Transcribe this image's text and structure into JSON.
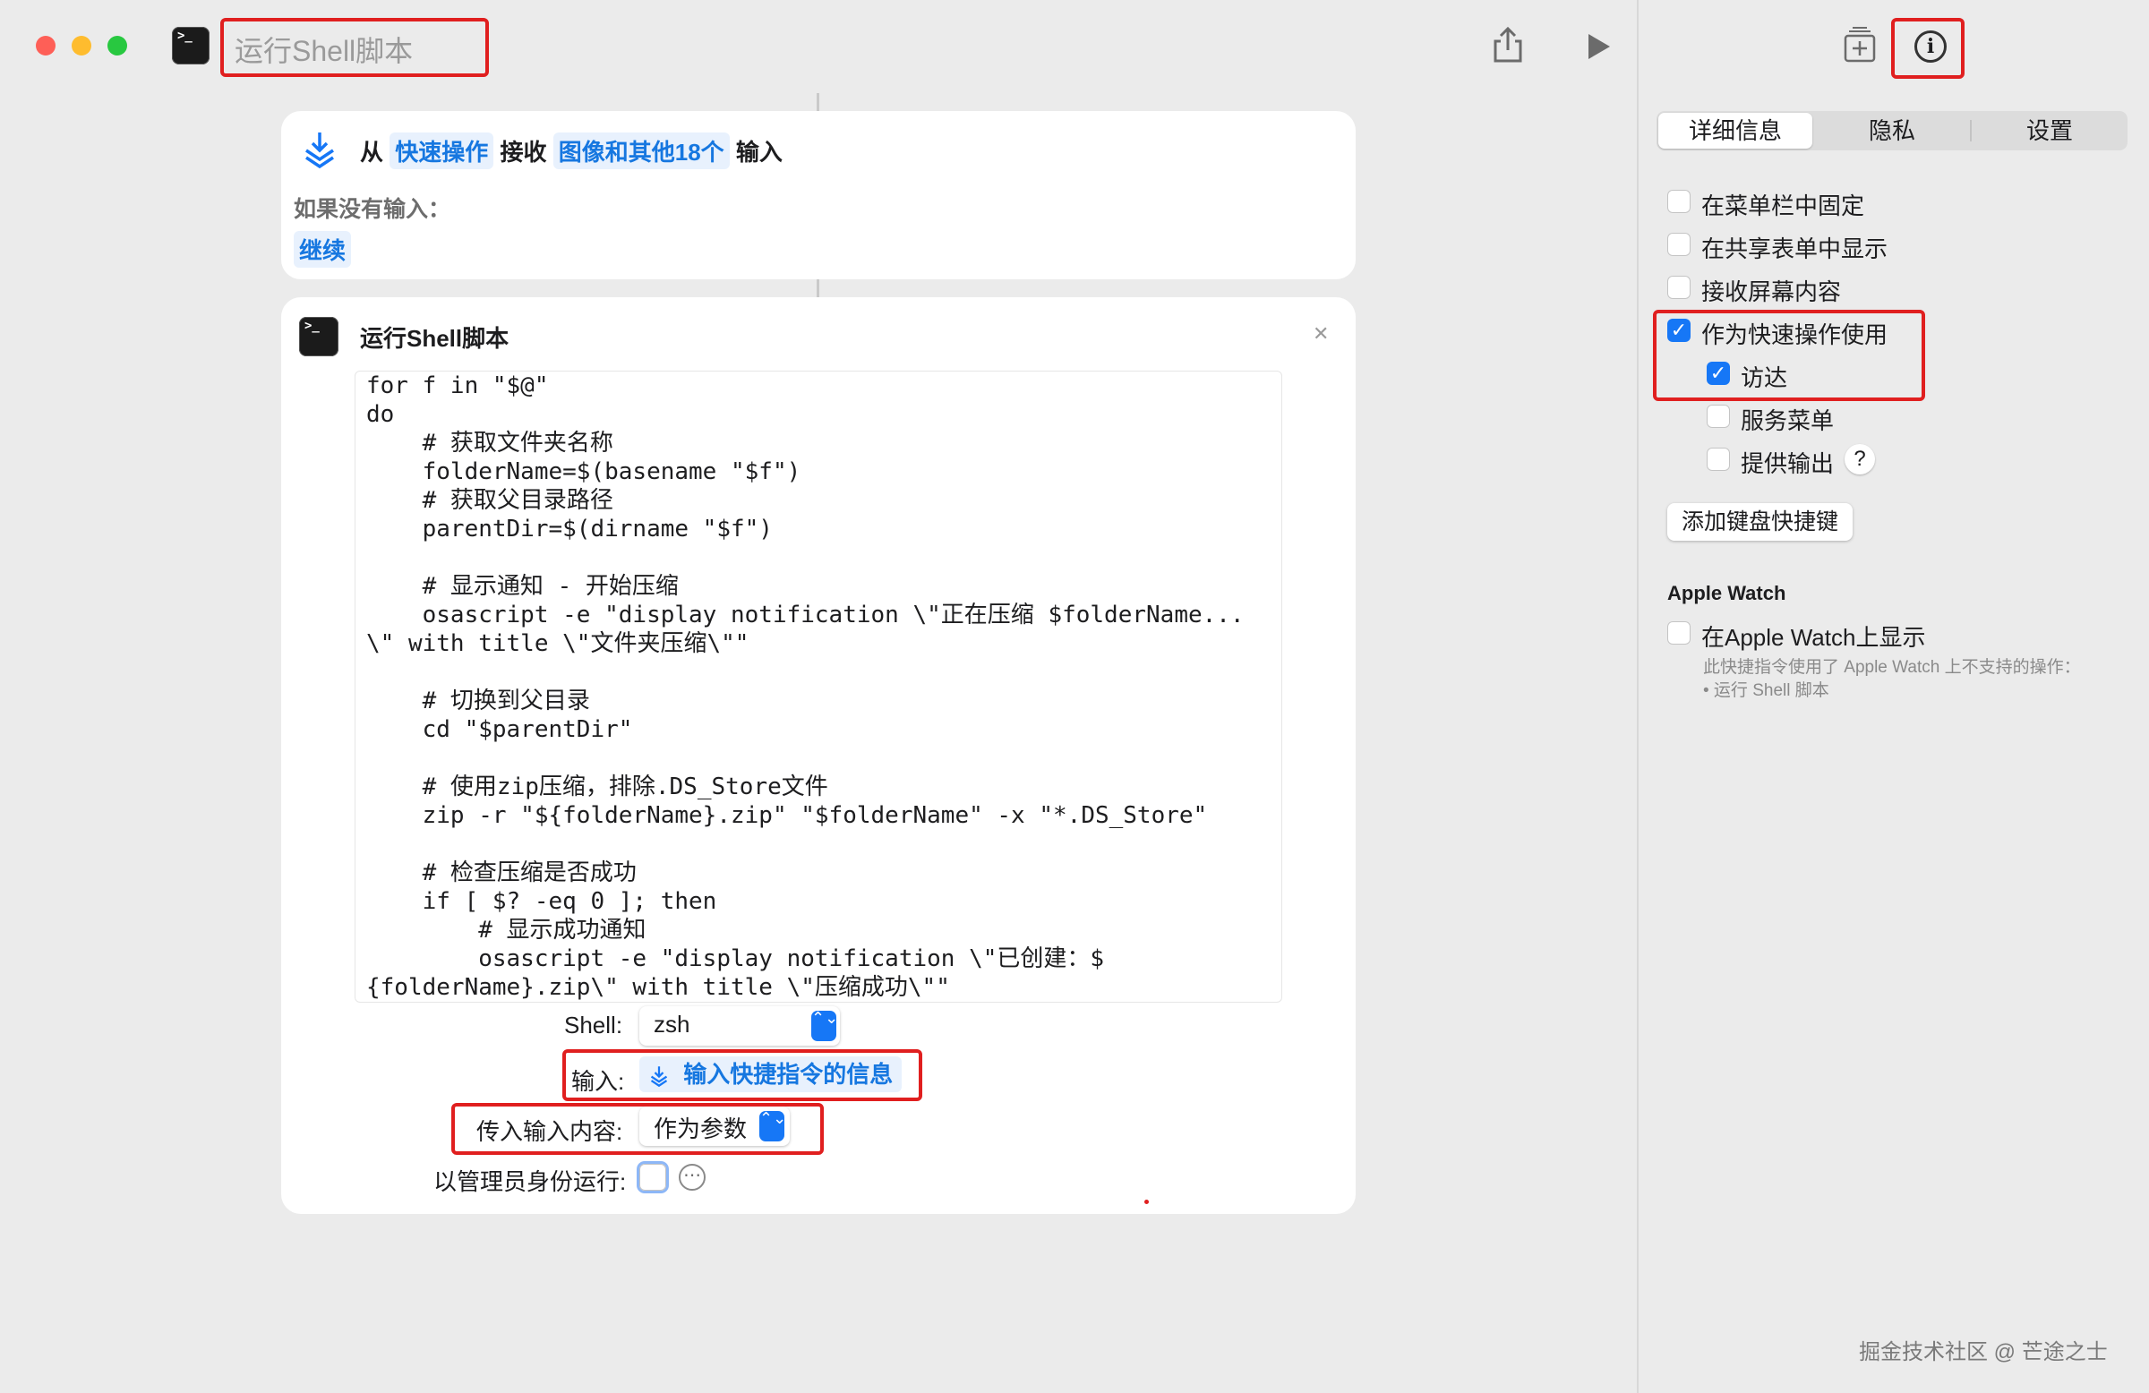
{
  "window": {
    "title": "运行Shell脚本"
  },
  "receive_card": {
    "from_label": "从",
    "source_token": "快速操作",
    "receive_label": "接收",
    "types_token": "图像和其他18个",
    "input_label": "输入",
    "no_input_label": "如果没有输入：",
    "no_input_action": "继续"
  },
  "shell_card": {
    "title": "运行Shell脚本",
    "script_lines": [
      "for f in \"$@\"",
      "do",
      "    # 获取文件夹名称",
      "    folderName=$(basename \"$f\")",
      "    # 获取父目录路径",
      "    parentDir=$(dirname \"$f\")",
      "",
      "    # 显示通知 - 开始压缩",
      "    osascript -e \"display notification \\\"正在压缩 $folderName...",
      "\\\" with title \\\"文件夹压缩\\\"\"",
      "",
      "    # 切换到父目录",
      "    cd \"$parentDir\"",
      "",
      "    # 使用zip压缩，排除.DS_Store文件",
      "    zip -r \"${folderName}.zip\" \"$folderName\" -x \"*.DS_Store\"",
      "",
      "    # 检查压缩是否成功",
      "    if [ $? -eq 0 ]; then",
      "        # 显示成功通知",
      "        osascript -e \"display notification \\\"已创建：$",
      "{folderName}.zip\\\" with title \\\"压缩成功\\\"\""
    ],
    "shell_label": "Shell:",
    "shell_value": "zsh",
    "input_label": "输入:",
    "input_value": "输入快捷指令的信息",
    "pass_label": "传入输入内容:",
    "pass_value": "作为参数",
    "admin_label": "以管理员身份运行:"
  },
  "sidebar": {
    "tabs": [
      "详细信息",
      "隐私",
      "设置"
    ],
    "active_tab": 0,
    "options": [
      {
        "label": "在菜单栏中固定",
        "checked": false
      },
      {
        "label": "在共享表单中显示",
        "checked": false
      },
      {
        "label": "接收屏幕内容",
        "checked": false
      },
      {
        "label": "作为快速操作使用",
        "checked": true
      },
      {
        "label": "访达",
        "checked": true
      },
      {
        "label": "服务菜单",
        "checked": false
      },
      {
        "label": "提供输出",
        "checked": false
      }
    ],
    "help_glyph": "?",
    "shortcut_button": "添加键盘快捷键",
    "watch_heading": "Apple Watch",
    "watch_option": "在Apple Watch上显示",
    "watch_note_1": "此快捷指令使用了 Apple Watch 上不支持的操作：",
    "watch_note_2": "• 运行 Shell 脚本"
  },
  "watermark": "掘金技术社区 @ 芒途之士",
  "icons": {
    "close_glyph": "✕",
    "check_glyph": "✓",
    "stepper_glyph": "⌃⌄",
    "more_glyph": "⋯",
    "info_glyph": "i",
    "prompt_glyph": ">_"
  },
  "colors": {
    "accent": "#1677f6",
    "highlight_box": "#e01f1f",
    "token_bg": "#e8f1fd"
  }
}
